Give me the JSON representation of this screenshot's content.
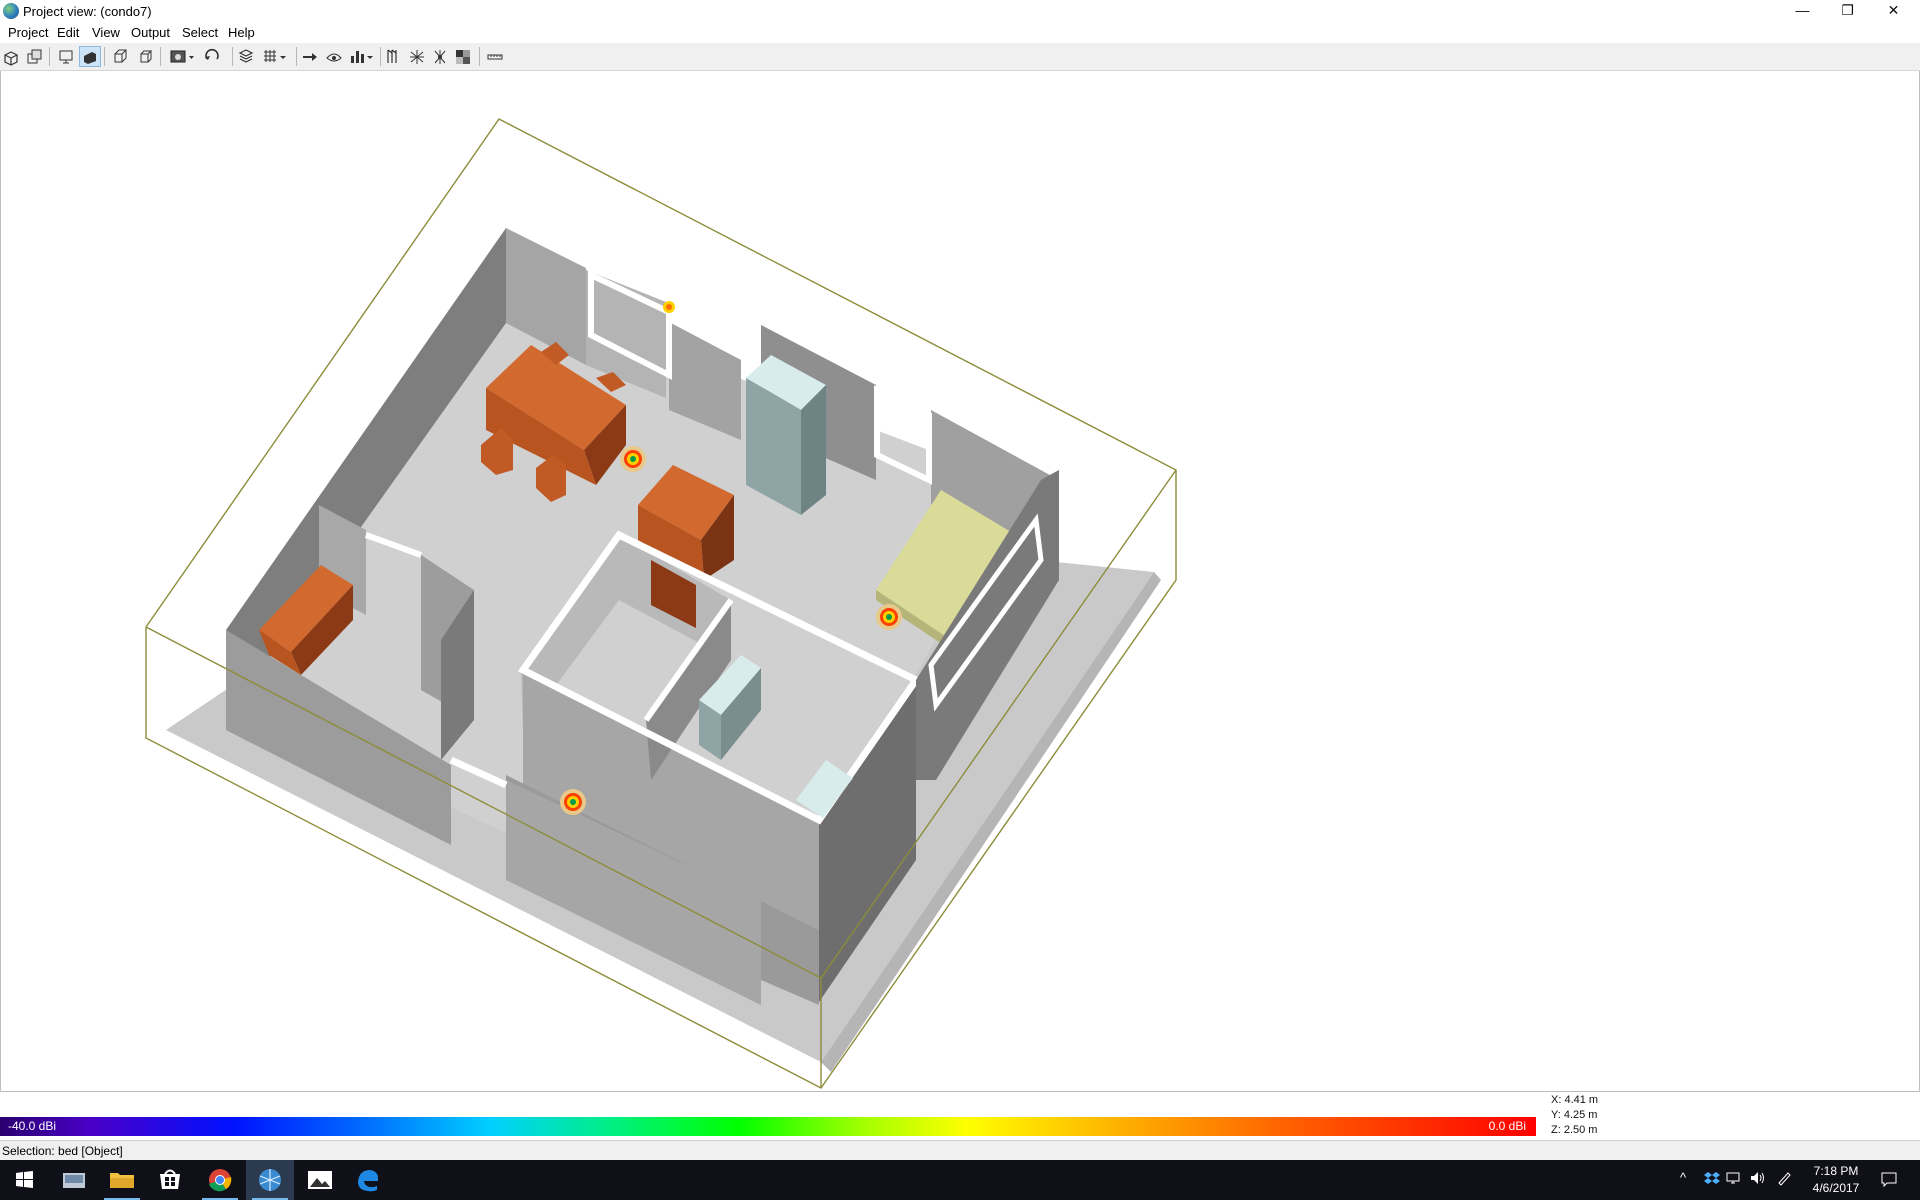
{
  "window": {
    "title": "Project view: (condo7)",
    "icon": "globe-app-icon",
    "buttons": [
      "minimize-icon",
      "restore-icon",
      "close-icon"
    ],
    "glyphs": {
      "minimize": "—",
      "restore": "❐",
      "close": "✕"
    }
  },
  "menu": {
    "items": [
      "Project",
      "Edit",
      "View",
      "Output",
      "Select",
      "Help"
    ]
  },
  "toolbar": {
    "icons": [
      "box-view-icon",
      "multi-box-icon",
      "camera-view-icon",
      "solid-view-icon",
      "wireframe-front-icon",
      "wireframe-side-icon",
      "capture-dropdown-icon",
      "rotate-icon",
      "layers-icon",
      "grid-dropdown-icon",
      "arrow-right-icon",
      "eye-icon",
      "bar-chart-dropdown-icon",
      "antenna-array-icon",
      "antenna-pattern-icon",
      "antenna-radiate-icon",
      "grayscale-toggle-icon",
      "ruler-icon"
    ],
    "active": [
      "solid-view-icon"
    ]
  },
  "coordinates": {
    "x": "X: 4.41 m",
    "y": "Y: 4.25 m",
    "z": "Z: 2.50 m"
  },
  "colorbar": {
    "min_label": "-40.0 dBi",
    "max_label": "0.0 dBi",
    "colors": [
      "#2a0070",
      "#0010ff",
      "#00d0ff",
      "#00ff00",
      "#ffff00",
      "#ff6000",
      "#ff0000"
    ]
  },
  "status": {
    "selection": "Selection: bed [Object]"
  },
  "scene": {
    "palette": {
      "bounding_box": "#8c8c3a",
      "floor": "#c8c8c8",
      "wall_light": "#a0a0a0",
      "wall_dark": "#7a7a7a",
      "furniture": "#d0692e",
      "bed": "#d8d898",
      "fridge": "#cfe3e3"
    },
    "antennas": [
      "antenna-marker",
      "antenna-marker",
      "antenna-marker",
      "antenna-marker"
    ]
  },
  "taskbar": {
    "apps": [
      "windows-start-icon",
      "photos-scanner-icon",
      "file-explorer-icon",
      "store-icon",
      "chrome-icon",
      "wireless-insite-icon",
      "photos-icon",
      "edge-icon"
    ],
    "tray_icons": [
      "chevron-up-icon",
      "dropbox-icon",
      "network-icon",
      "volume-icon",
      "pen-icon",
      "action-center-icon"
    ],
    "time": "7:18 PM",
    "date": "4/6/2017"
  }
}
